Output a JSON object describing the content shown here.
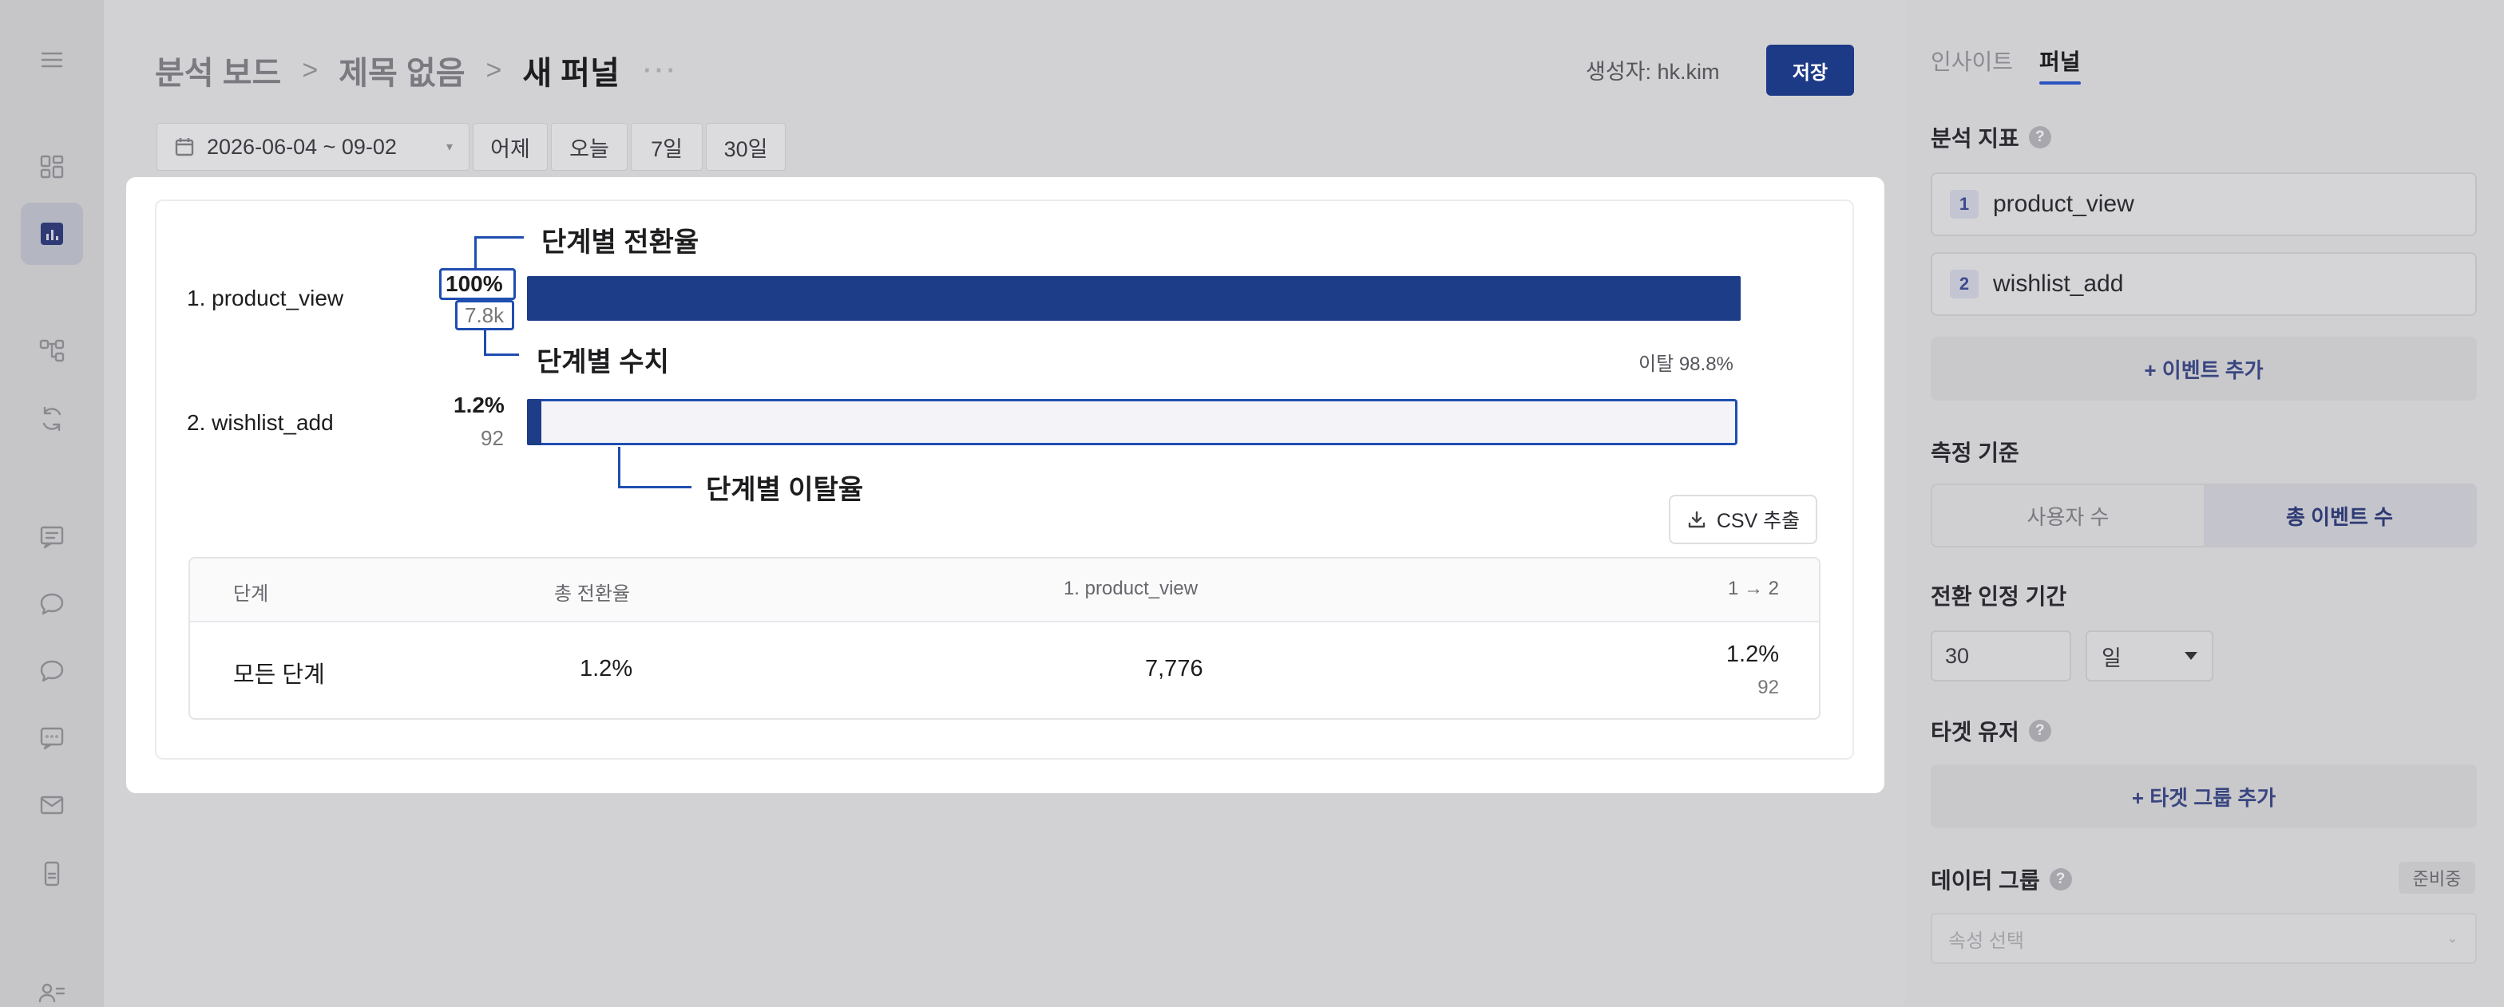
{
  "header": {
    "breadcrumbs": [
      "분석 보드",
      "제목 없음",
      "새 퍼널"
    ],
    "separator": ">",
    "more": "···",
    "creator": "생성자: hk.kim",
    "save_label": "저장"
  },
  "date_range": {
    "value": "2026-06-04 ~ 09-02",
    "presets": [
      "어제",
      "오늘",
      "7일",
      "30일"
    ]
  },
  "funnel": {
    "steps": [
      {
        "label": "1. product_view",
        "rate": "100%",
        "count": "7.8k",
        "conversion": 1.0
      },
      {
        "label": "2. wishlist_add",
        "rate": "1.2%",
        "count": "92",
        "conversion": 0.012
      }
    ],
    "dropoff_text": "이탈 98.8%",
    "annotations": {
      "conversion_rate": "단계별 전환율",
      "step_count": "단계별 수치",
      "dropoff_rate": "단계별 이탈율"
    }
  },
  "csv_label": "CSV 추출",
  "table": {
    "headers": [
      "단계",
      "총 전환율",
      "1. product_view",
      "1 → 2"
    ],
    "row": {
      "stage": "모든 단계",
      "total": "1.2%",
      "step1": "7,776",
      "step12_rate": "1.2%",
      "step12_count": "92"
    }
  },
  "panel": {
    "tabs": [
      "인사이트",
      "퍼널"
    ],
    "metrics_title": "분석 지표",
    "events": [
      {
        "num": "1",
        "name": "product_view"
      },
      {
        "num": "2",
        "name": "wishlist_add"
      }
    ],
    "add_event": "+ 이벤트 추가",
    "measure_title": "측정 기준",
    "measure_options": [
      "사용자 수",
      "총 이벤트 수"
    ],
    "period_title": "전환 인정 기간",
    "period_value": "30",
    "period_unit": "일",
    "target_title": "타겟 유저",
    "add_target": "+ 타겟 그룹 추가",
    "group_title": "데이터 그룹",
    "preparing": "준비중",
    "property_placeholder": "속성 선택",
    "help": "?"
  }
}
